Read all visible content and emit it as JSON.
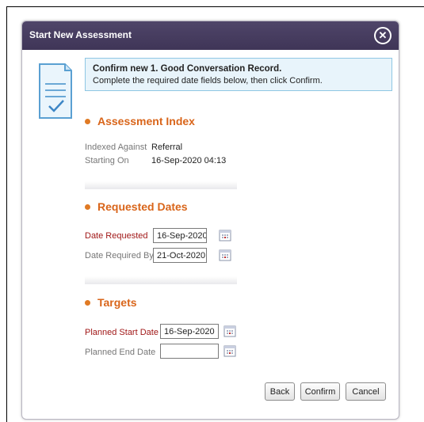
{
  "dialog": {
    "title": "Start New Assessment",
    "close_icon": "close-circle-icon"
  },
  "message": {
    "line1": "Confirm new 1. Good Conversation Record.",
    "line2": "Complete the required date fields below, then click Confirm."
  },
  "assessment_index": {
    "heading": "Assessment Index",
    "indexed_label": "Indexed Against",
    "indexed_value": "Referral",
    "starting_label": "Starting On",
    "starting_value": "16-Sep-2020 04:13"
  },
  "requested_dates": {
    "heading": "Requested Dates",
    "requested_label": "Date Requested",
    "requested_value": "16-Sep-2020",
    "required_label": "Date Required By",
    "required_value": "21-Oct-2020"
  },
  "targets": {
    "heading": "Targets",
    "start_label": "Planned Start Date",
    "start_value": "16-Sep-2020",
    "end_label": "Planned End Date",
    "end_value": ""
  },
  "buttons": {
    "back": "Back",
    "confirm": "Confirm",
    "cancel": "Cancel"
  },
  "colors": {
    "titlebar": "#443a5e",
    "heading_orange": "#d9651a",
    "required_red": "#a11818",
    "info_bg": "#e8f4fb"
  }
}
